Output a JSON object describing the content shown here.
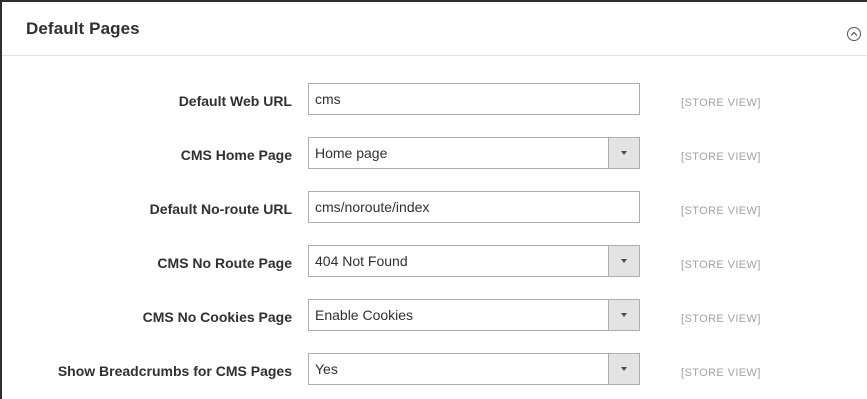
{
  "section": {
    "title": "Default Pages"
  },
  "fields": {
    "default_web_url": {
      "label": "Default Web URL",
      "value": "cms",
      "scope": "[STORE VIEW]"
    },
    "cms_home_page": {
      "label": "CMS Home Page",
      "selected": "Home page",
      "scope": "[STORE VIEW]"
    },
    "default_no_route_url": {
      "label": "Default No-route URL",
      "value": "cms/noroute/index",
      "scope": "[STORE VIEW]"
    },
    "cms_no_route_page": {
      "label": "CMS No Route Page",
      "selected": "404 Not Found",
      "scope": "[STORE VIEW]"
    },
    "cms_no_cookies_page": {
      "label": "CMS No Cookies Page",
      "selected": "Enable Cookies",
      "scope": "[STORE VIEW]"
    },
    "show_breadcrumbs": {
      "label": "Show Breadcrumbs for CMS Pages",
      "selected": "Yes",
      "scope": "[STORE VIEW]"
    }
  },
  "icons": {
    "collapse": "chevron-up-circle-icon",
    "dropdown": "caret-down-icon"
  },
  "colors": {
    "border": "#adadad",
    "select_button_bg": "#e3e3e3",
    "scope_text": "#a2a2a2",
    "label_text": "#303030"
  }
}
